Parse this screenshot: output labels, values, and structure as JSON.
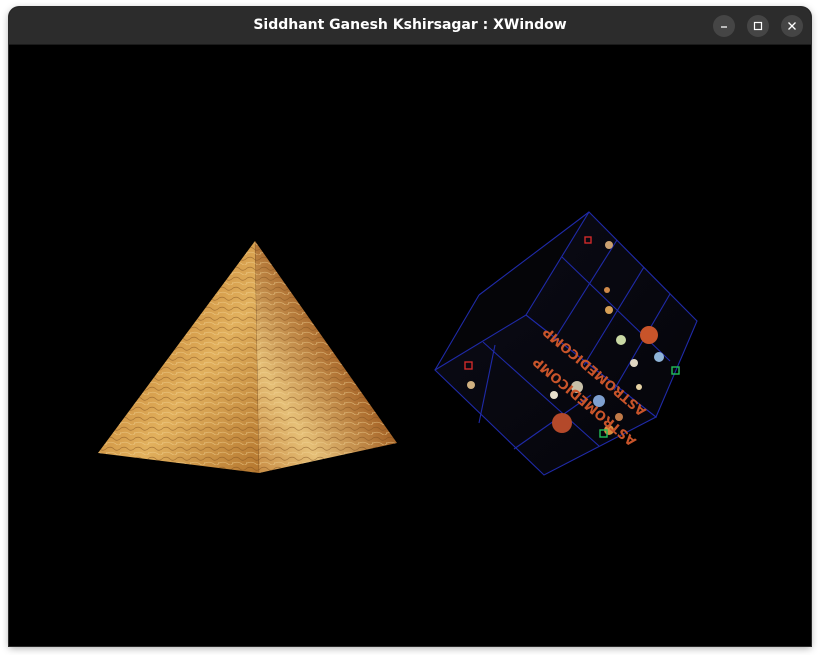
{
  "window": {
    "title": "Siddhant Ganesh Kshirsagar : XWindow",
    "controls": [
      {
        "name": "minimize",
        "icon": "minimize-icon"
      },
      {
        "name": "maximize",
        "icon": "maximize-icon"
      },
      {
        "name": "close",
        "icon": "close-icon"
      }
    ]
  },
  "scene": {
    "background_color": "#000000",
    "pyramid": {
      "texture": "sandstone",
      "colors": [
        "#c98a3a",
        "#e2b15e",
        "#8a5a28",
        "#f0cf8a"
      ]
    },
    "cube": {
      "texture": "astromedicomp",
      "face_text": "ASTROMEDICOMP",
      "grid_color": "#1f2aa8",
      "text_color": "#c8542a"
    }
  }
}
